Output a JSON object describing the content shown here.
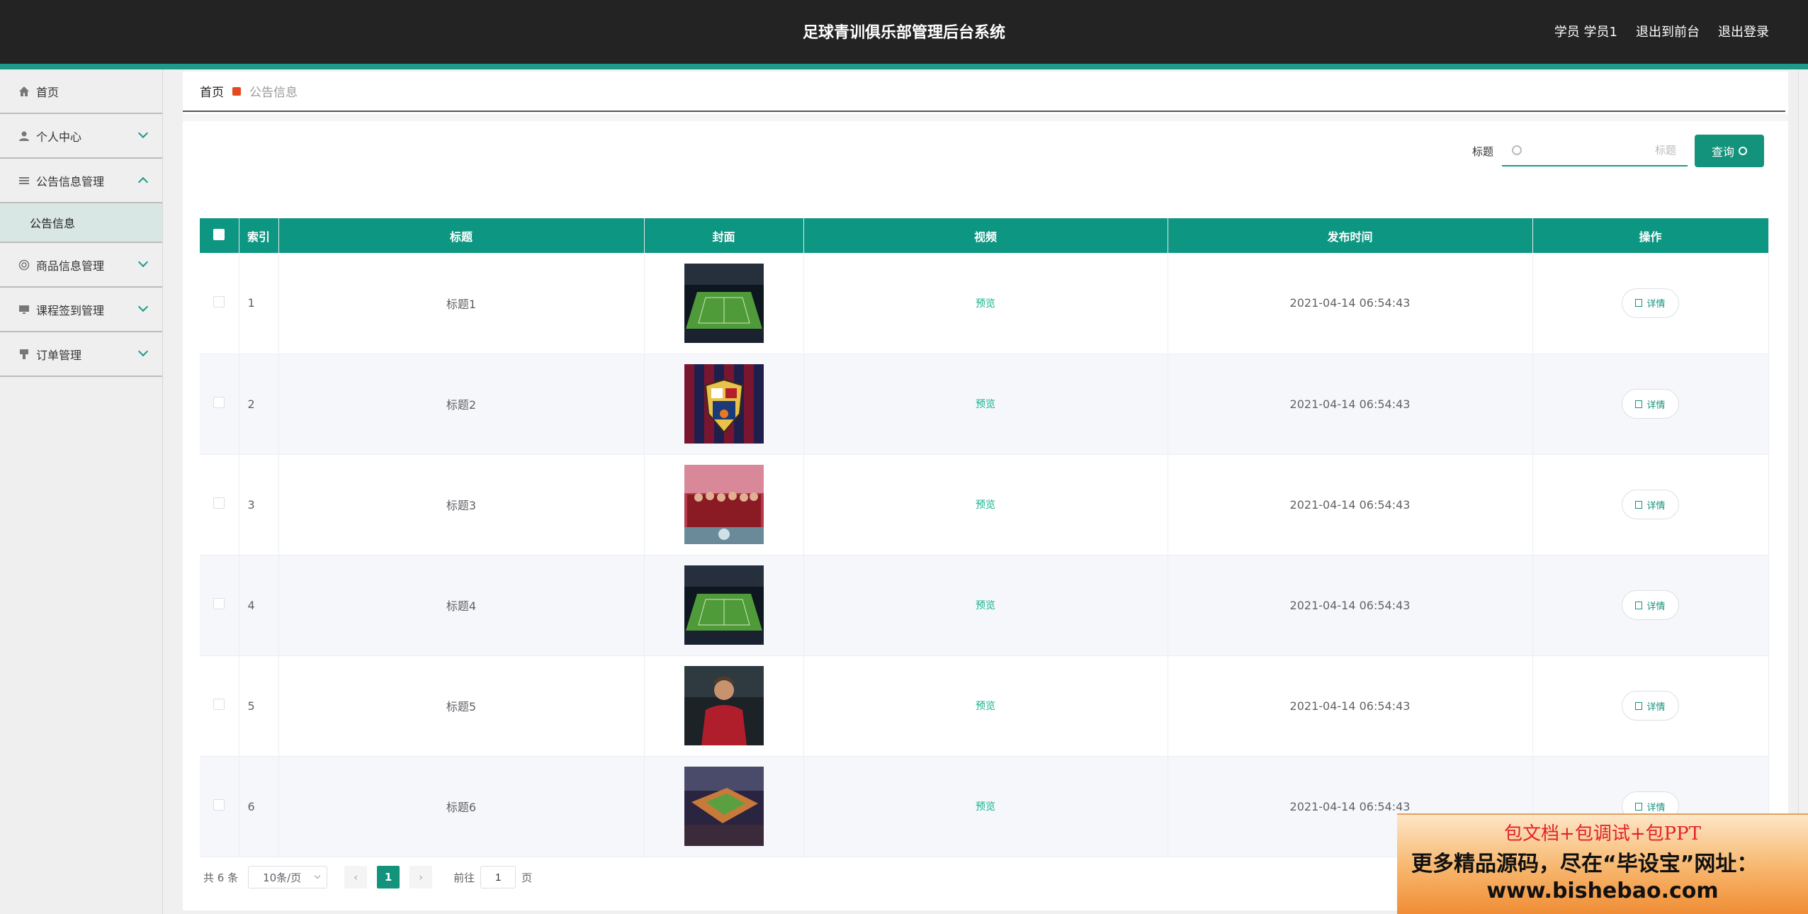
{
  "header": {
    "title": "足球青训俱乐部管理后台系统",
    "user": "学员 学员1",
    "to_front": "退出到前台",
    "logout": "退出登录"
  },
  "sidebar": {
    "items": [
      {
        "label": "首页",
        "icon": "home-icon"
      },
      {
        "label": "个人中心",
        "icon": "user-icon"
      },
      {
        "label": "公告信息管理",
        "icon": "list-icon"
      },
      {
        "label": "商品信息管理",
        "icon": "goods-icon"
      },
      {
        "label": "课程签到管理",
        "icon": "monitor-icon"
      },
      {
        "label": "订单管理",
        "icon": "order-icon"
      }
    ],
    "sub_active": "公告信息"
  },
  "breadcrumb": {
    "home": "首页",
    "current": "公告信息"
  },
  "search": {
    "label": "标题",
    "placeholder": "标题",
    "button": "查询"
  },
  "table": {
    "headers": [
      "索引",
      "标题",
      "封面",
      "视频",
      "发布时间",
      "操作"
    ],
    "rows": [
      {
        "index": "1",
        "title": "标题1",
        "cover": "stadium",
        "video": "预览",
        "time": "2021-04-14 06:54:43",
        "action": "详情"
      },
      {
        "index": "2",
        "title": "标题2",
        "cover": "crest",
        "video": "预览",
        "time": "2021-04-14 06:54:43",
        "action": "详情"
      },
      {
        "index": "3",
        "title": "标题3",
        "cover": "team",
        "video": "预览",
        "time": "2021-04-14 06:54:43",
        "action": "详情"
      },
      {
        "index": "4",
        "title": "标题4",
        "cover": "stadium",
        "video": "预览",
        "time": "2021-04-14 06:54:43",
        "action": "详情"
      },
      {
        "index": "5",
        "title": "标题5",
        "cover": "player",
        "video": "预览",
        "time": "2021-04-14 06:54:43",
        "action": "详情"
      },
      {
        "index": "6",
        "title": "标题6",
        "cover": "arena",
        "video": "预览",
        "time": "2021-04-14 06:54:43",
        "action": "详情"
      }
    ]
  },
  "pagination": {
    "total": "共 6 条",
    "page_size": "10条/页",
    "current": "1",
    "goto_prefix": "前往",
    "goto_value": "1",
    "goto_suffix": "页"
  },
  "ad": {
    "line1": "包文档+包调试+包PPT",
    "line2": "更多精品源码，尽在“毕设宝”网址：",
    "line3": "www.bishebao.com"
  },
  "colors": {
    "accent": "#13927c",
    "header_bg": "#232323",
    "table_head": "#0d9682"
  }
}
